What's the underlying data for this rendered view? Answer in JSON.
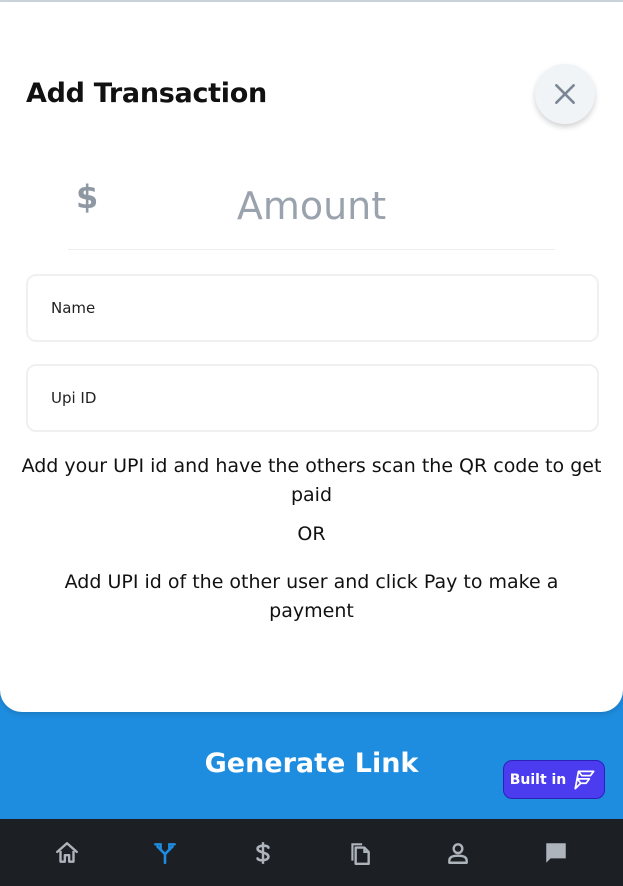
{
  "modal": {
    "title": "Add Transaction",
    "close_icon": "close-icon"
  },
  "amount": {
    "currency_symbol": "$",
    "placeholder": "Amount"
  },
  "fields": {
    "name_placeholder": "Name",
    "upi_placeholder": "Upi ID"
  },
  "info": {
    "line1": "Add your UPI id and have the others scan the QR code to get paid",
    "or": "OR",
    "line2": "Add UPI id of the other user and click Pay  to make a payment"
  },
  "generate": {
    "label": "Generate Link"
  },
  "badge": {
    "label": "Built in"
  },
  "nav": {
    "items": [
      {
        "icon": "home-icon",
        "active": false
      },
      {
        "icon": "split-icon",
        "active": true
      },
      {
        "icon": "dollar-icon",
        "active": false
      },
      {
        "icon": "copy-icon",
        "active": false
      },
      {
        "icon": "person-icon",
        "active": false
      },
      {
        "icon": "chat-icon",
        "active": false
      }
    ]
  },
  "colors": {
    "primary": "#1e8de0",
    "nav_bg": "#1c1f24",
    "nav_icon": "#aeb4bb",
    "nav_active": "#1e8de0",
    "badge": "#4b3cf0"
  }
}
